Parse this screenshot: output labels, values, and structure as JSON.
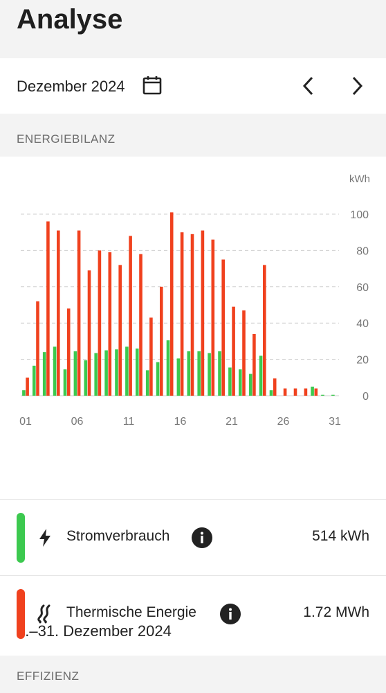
{
  "page": {
    "title": "Analyse"
  },
  "month_selector": {
    "label": "Dezember 2024"
  },
  "sections": {
    "energy": "ENERGIEBILANZ",
    "efficiency": "EFFIZIENZ"
  },
  "summary": {
    "period": "1.–31. Dezember 2024",
    "rows": [
      {
        "label": "Stromverbrauch",
        "value": "514 kWh",
        "color": "#3cc94f",
        "icon": "lightning-icon"
      },
      {
        "label": "Thermische Energie",
        "value": "1.72 MWh",
        "color": "#f0411e",
        "icon": "heat-waves-icon"
      }
    ]
  },
  "chart_data": {
    "type": "bar",
    "unit": "kWh",
    "ylim": [
      0,
      100
    ],
    "yticks": [
      0,
      20,
      40,
      60,
      80,
      100
    ],
    "xtick_labels": [
      "01",
      "06",
      "11",
      "16",
      "21",
      "26",
      "31"
    ],
    "grid": true,
    "categories": [
      1,
      2,
      3,
      4,
      5,
      6,
      7,
      8,
      9,
      10,
      11,
      12,
      13,
      14,
      15,
      16,
      17,
      18,
      19,
      20,
      21,
      22,
      23,
      24,
      25,
      26,
      27,
      28,
      29,
      30,
      31
    ],
    "series": [
      {
        "color": "#3cc94f",
        "values": [
          3,
          16.5,
          24,
          27,
          14.5,
          24.5,
          19.5,
          23.5,
          25,
          25.5,
          27,
          26,
          14,
          18.5,
          30.5,
          20.5,
          24.5,
          24.5,
          23.5,
          24.5,
          15.5,
          14.5,
          12,
          22,
          3,
          0,
          0,
          0,
          5,
          0.5,
          0.5
        ]
      },
      {
        "color": "#f0411e",
        "values": [
          10,
          52,
          96,
          91,
          48,
          91,
          69,
          80,
          79,
          72,
          88,
          78,
          43,
          60,
          101,
          90,
          89,
          91,
          86,
          75,
          49,
          47,
          34,
          72,
          9.5,
          4,
          4,
          4,
          4,
          0,
          0
        ]
      }
    ]
  }
}
